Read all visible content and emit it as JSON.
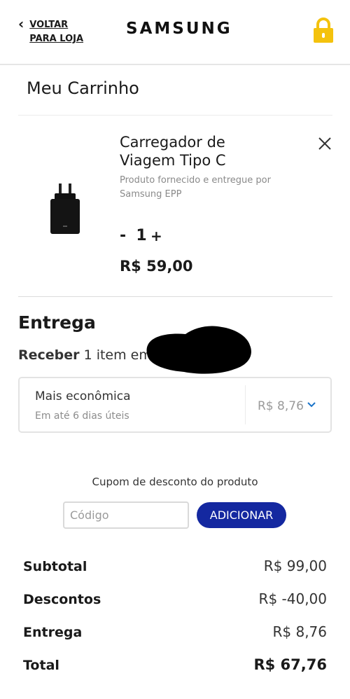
{
  "header": {
    "back_line1": "VOLTAR",
    "back_line2": "PARA LOJA",
    "logo": "SAMSUNG",
    "lock_color": "#f4c20d"
  },
  "cart": {
    "title": "Meu Carrinho",
    "product": {
      "name_line1": "Carregador de",
      "name_line2": "Viagem Tipo C",
      "sold_by": "Produto fornecido e entregue por Samsung EPP",
      "qty_minus": "-",
      "quantity": "1",
      "qty_plus": "+",
      "price": "R$ 59,00"
    }
  },
  "delivery": {
    "title": "Entrega",
    "receive_bold": "Receber",
    "receive_text": "1 item em",
    "option_name": "Mais econômica",
    "option_eta": "Em até 6 dias úteis",
    "option_price": "R$ 8,76"
  },
  "coupon": {
    "label": "Cupom de desconto do produto",
    "placeholder": "Código",
    "button": "ADICIONAR",
    "button_color": "#1428a0"
  },
  "summary": {
    "subtotal_label": "Subtotal",
    "subtotal_value": "R$ 99,00",
    "discount_label": "Descontos",
    "discount_value": "R$ -40,00",
    "shipping_label": "Entrega",
    "shipping_value": "R$ 8,76",
    "total_label": "Total",
    "total_value": "R$ 67,76"
  }
}
